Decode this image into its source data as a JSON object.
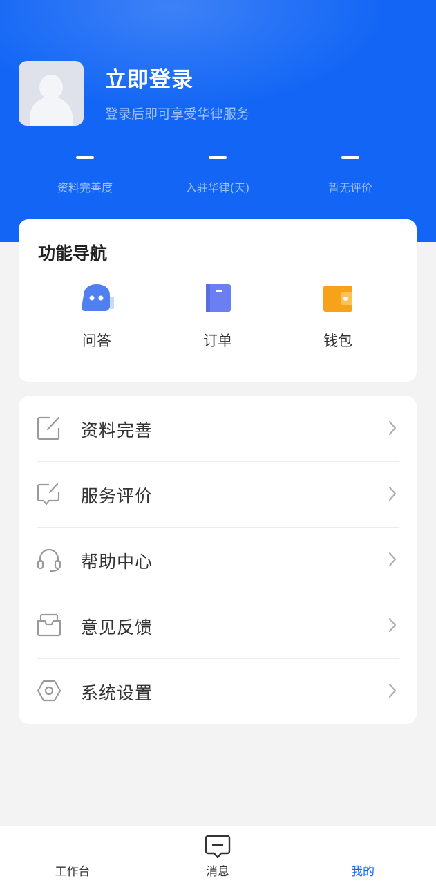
{
  "header": {
    "title": "立即登录",
    "subtitle": "登录后即可享受华律服务"
  },
  "stats": [
    {
      "value": "–",
      "label": "资料完善度"
    },
    {
      "value": "–",
      "label": "入驻华律(天)"
    },
    {
      "value": "–",
      "label": "暂无评价"
    }
  ],
  "nav": {
    "title": "功能导航",
    "items": [
      {
        "label": "问答",
        "icon": "chat-bot-icon",
        "color": "#4f7ff0"
      },
      {
        "label": "订单",
        "icon": "order-book-icon",
        "color": "#6b7ff2"
      },
      {
        "label": "钱包",
        "icon": "wallet-icon",
        "color": "#f7a21b"
      }
    ]
  },
  "menu": [
    {
      "label": "资料完善",
      "icon": "edit-icon"
    },
    {
      "label": "服务评价",
      "icon": "review-icon"
    },
    {
      "label": "帮助中心",
      "icon": "headset-icon"
    },
    {
      "label": "意见反馈",
      "icon": "feedback-icon"
    },
    {
      "label": "系统设置",
      "icon": "settings-icon"
    }
  ],
  "tabbar": {
    "tabs": [
      {
        "label": "工作台"
      },
      {
        "label": "消息",
        "icon": "message-icon"
      },
      {
        "label": "我的"
      }
    ],
    "active_color": "#1366f5"
  }
}
